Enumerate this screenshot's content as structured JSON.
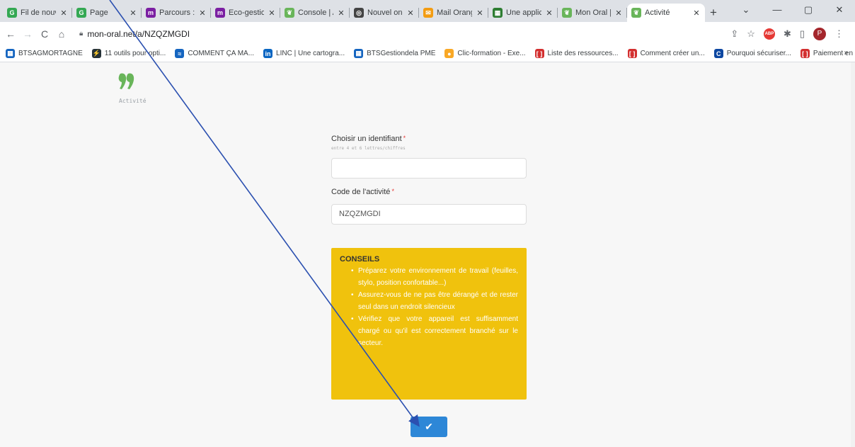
{
  "tabs": [
    {
      "label": "Fil de nouve",
      "fav": "G",
      "color": "#34a853"
    },
    {
      "label": "Page",
      "fav": "G",
      "color": "#34a853"
    },
    {
      "label": "Parcours : E",
      "fav": "m",
      "color": "#7b1fa2"
    },
    {
      "label": "Eco-gestion",
      "fav": "m",
      "color": "#7b1fa2"
    },
    {
      "label": "Console | A",
      "fav": "❦",
      "color": "#69b55a"
    },
    {
      "label": "Nouvel ong",
      "fav": "◎",
      "color": "#444"
    },
    {
      "label": "Mail Orange",
      "fav": "✉",
      "color": "#f39c12"
    },
    {
      "label": "Une applica",
      "fav": "▦",
      "color": "#2e7d32"
    },
    {
      "label": "Mon Oral |",
      "fav": "❦",
      "color": "#69b55a"
    }
  ],
  "active_tab": {
    "label": "Activité",
    "fav": "❦",
    "color": "#69b55a"
  },
  "window_controls": {
    "minimize": "—",
    "maximize": "▢",
    "close": "✕",
    "dropdown": "⌄"
  },
  "url": "mon-oral.net/a/NZQZMGDI",
  "bookmarks": [
    {
      "label": "BTSAGMORTAGNE",
      "fav": "▦",
      "color": "#1565c0"
    },
    {
      "label": "11 outils pour opti...",
      "fav": "⚡",
      "color": "#263238"
    },
    {
      "label": "COMMENT ÇA MA...",
      "fav": "≈",
      "color": "#1565c0"
    },
    {
      "label": "LINC | Une cartogra...",
      "fav": "in",
      "color": "#0a66c2"
    },
    {
      "label": "BTSGestiondela PME",
      "fav": "▦",
      "color": "#1565c0"
    },
    {
      "label": "Clic-formation - Exe...",
      "fav": "●",
      "color": "#f9a825"
    },
    {
      "label": "Liste des ressources...",
      "fav": "[ ]",
      "color": "#d32f2f"
    },
    {
      "label": "Comment créer un...",
      "fav": "[ ]",
      "color": "#d32f2f"
    },
    {
      "label": "Pourquoi sécuriser...",
      "fav": "C",
      "color": "#0d47a1"
    },
    {
      "label": "Paiement en ligne :...",
      "fav": "[ ]",
      "color": "#d32f2f"
    }
  ],
  "bookmarks_more": "»",
  "page": {
    "logo_label": "Activité",
    "identifier_label": "Choisir un identifiant",
    "identifier_hint": "entre 4 et 6 lettres/chiffres",
    "identifier_value": "",
    "code_label": "Code de l'activité",
    "code_value": "NZQZMGDI",
    "required_mark": "*",
    "advice_title": "CONSEILS",
    "advice_items": [
      "Préparez votre environnement de travail (feuilles, stylo, position confortable...)",
      "Assurez-vous de ne pas être dérangé et de rester seul dans un endroit silencieux",
      "Vérifiez que votre appareil est suffisamment chargé ou qu'il est correctement branché sur le secteur."
    ],
    "submit_icon": "✔"
  },
  "colors": {
    "accent": "#2d87d7",
    "advice_bg": "#f0c20d",
    "logo": "#69b55a",
    "arrow": "#2b50b0"
  }
}
